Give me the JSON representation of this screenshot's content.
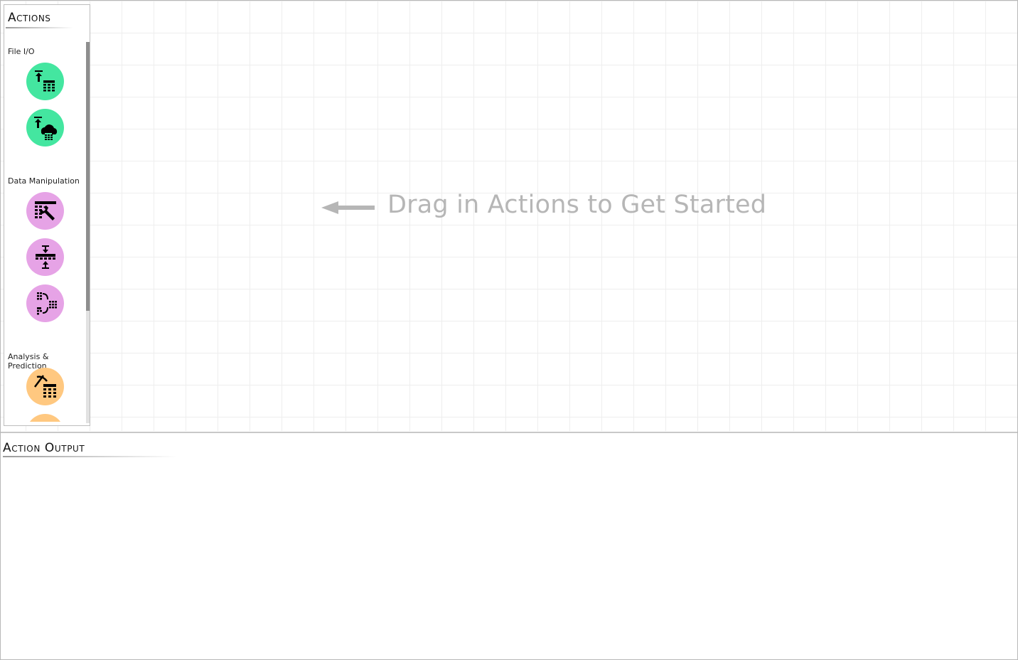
{
  "actions_panel": {
    "title": "Actions",
    "sections": [
      {
        "label": "File I/O",
        "color": "#44e6a0",
        "items": [
          {
            "icon": "upload-table-icon"
          },
          {
            "icon": "upload-cloud-table-icon"
          }
        ]
      },
      {
        "label": "Data Manipulation",
        "color": "#e6a3e6",
        "items": [
          {
            "icon": "table-wrench-icon"
          },
          {
            "icon": "table-merge-rows-icon"
          },
          {
            "icon": "table-join-icon"
          }
        ]
      },
      {
        "label": "Analysis & Prediction",
        "color": "#ffc880",
        "items": [
          {
            "icon": "pickaxe-table-icon"
          },
          {
            "icon": "analysis-icon"
          }
        ]
      }
    ]
  },
  "canvas": {
    "hint": "Drag in Actions to Get Started"
  },
  "output": {
    "title": "Action Output"
  }
}
